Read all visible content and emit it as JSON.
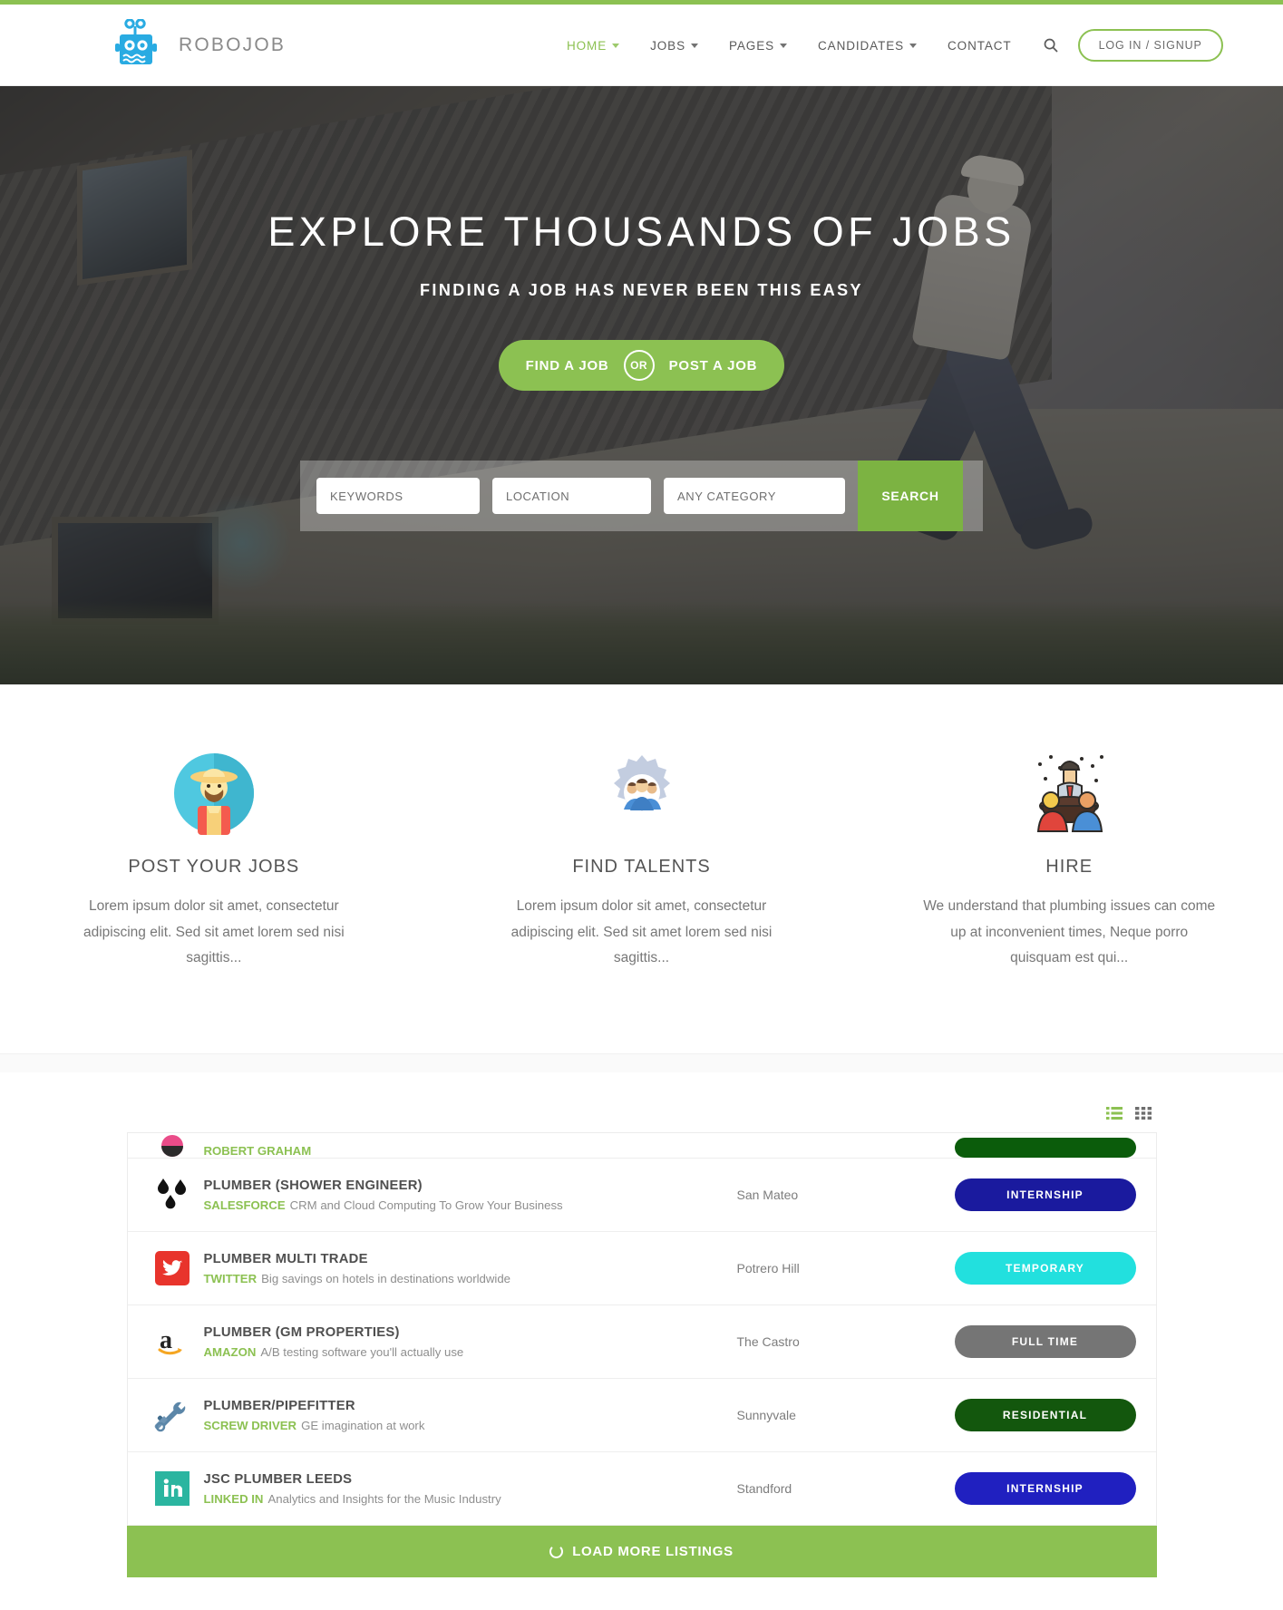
{
  "brand": {
    "name": "ROBOJOB",
    "logo_icon": "robot-icon",
    "accent": "#29abe2"
  },
  "nav": {
    "items": [
      {
        "label": "HOME",
        "has_caret": true,
        "active": true
      },
      {
        "label": "JOBS",
        "has_caret": true,
        "active": false
      },
      {
        "label": "PAGES",
        "has_caret": true,
        "active": false
      },
      {
        "label": "CANDIDATES",
        "has_caret": true,
        "active": false
      },
      {
        "label": "CONTACT",
        "has_caret": false,
        "active": false
      }
    ],
    "search_icon": "search-icon",
    "login_label": "LOG IN / SIGNUP"
  },
  "hero": {
    "title": "EXPLORE THOUSANDS OF JOBS",
    "subtitle": "FINDING A JOB HAS NEVER BEEN THIS EASY",
    "cta_left": "FIND A JOB",
    "cta_or": "OR",
    "cta_right": "POST A JOB",
    "accent": "#8cc152"
  },
  "search": {
    "keywords_placeholder": "KEYWORDS",
    "keywords_value": "",
    "location_placeholder": "LOCATION",
    "location_value": "",
    "category_placeholder": "ANY CATEGORY",
    "category_value": "",
    "button_label": "SEARCH"
  },
  "features": [
    {
      "icon": "farmer-avatar-icon",
      "title": "POST YOUR JOBS",
      "text": "Lorem ipsum dolor sit amet, consectetur adipiscing elit. Sed sit amet lorem sed nisi sagittis..."
    },
    {
      "icon": "gear-people-icon",
      "title": "FIND TALENTS",
      "text": "Lorem ipsum dolor sit amet, consectetur adipiscing elit. Sed sit amet lorem sed nisi sagittis..."
    },
    {
      "icon": "meeting-table-icon",
      "title": "HIRE",
      "text": "We understand that plumbing issues can come up at inconvenient times, Neque porro quisquam est qui..."
    }
  ],
  "listings": {
    "view_list_icon": "list-view-icon",
    "view_grid_icon": "grid-view-icon",
    "rows": [
      {
        "logo": "dribbble-icon",
        "title": "",
        "company": "ROBERT GRAHAM",
        "description": "",
        "location": "",
        "badge": {
          "label": "",
          "color": "#0b5c0b"
        },
        "partial": true
      },
      {
        "logo": "water-drops-icon",
        "title": "PLUMBER (SHOWER ENGINEER)",
        "company": "SALESFORCE",
        "description": "CRM and Cloud Computing To Grow Your Business",
        "location": "San Mateo",
        "badge": {
          "label": "INTERNSHIP",
          "color": "#1a1a9e"
        },
        "partial": false
      },
      {
        "logo": "twitter-icon",
        "title": "PLUMBER MULTI TRADE",
        "company": "TWITTER",
        "description": "Big savings on hotels in destinations worldwide",
        "location": "Potrero Hill",
        "badge": {
          "label": "TEMPORARY",
          "color": "#22e0de"
        },
        "partial": false
      },
      {
        "logo": "amazon-icon",
        "title": "PLUMBER (GM PROPERTIES)",
        "company": "AMAZON",
        "description": "A/B testing software you'll actually use",
        "location": "The Castro",
        "badge": {
          "label": "FULL TIME",
          "color": "#757575"
        },
        "partial": false
      },
      {
        "logo": "screwdriver-wrench-icon",
        "title": "PLUMBER/PIPEFITTER",
        "company": "SCREW DRIVER",
        "description": "GE imagination at work",
        "location": "Sunnyvale",
        "badge": {
          "label": "RESIDENTIAL",
          "color": "#13570d"
        },
        "partial": false
      },
      {
        "logo": "linkedin-icon",
        "title": "JSC PLUMBER LEEDS",
        "company": "LINKED IN",
        "description": "Analytics and Insights for the Music Industry",
        "location": "Standford",
        "badge": {
          "label": "INTERNSHIP",
          "color": "#2020c0"
        },
        "partial": false
      }
    ],
    "load_more_label": "LOAD MORE LISTINGS",
    "load_more_icon": "spinner-icon"
  }
}
